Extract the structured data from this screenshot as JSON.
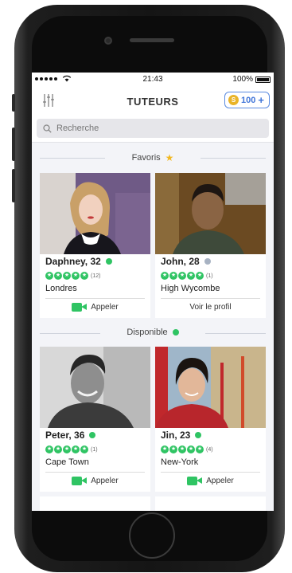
{
  "status_bar": {
    "time": "21:43",
    "battery": "100%"
  },
  "nav": {
    "title": "TUTEURS",
    "coins": "100",
    "coin_symbol": "S"
  },
  "search": {
    "placeholder": "Recherche"
  },
  "sections": {
    "favorites": "Favoris",
    "available": "Disponible"
  },
  "tutors": [
    {
      "name": "Daphney, 32",
      "online": true,
      "reviews": "(12)",
      "city": "Londres",
      "action": "Appeler",
      "photo_tone": "#8a6b9a"
    },
    {
      "name": "John, 28",
      "online": false,
      "reviews": "(1)",
      "city": "High Wycombe",
      "action": "Voir le profil",
      "photo_tone": "#7a5a2e"
    },
    {
      "name": "Peter, 36",
      "online": true,
      "reviews": "(1)",
      "city": "Cape Town",
      "action": "Appeler",
      "photo_tone": "#3a3a3a"
    },
    {
      "name": "Jin, 23",
      "online": true,
      "reviews": "(4)",
      "city": "New-York",
      "action": "Appeler",
      "photo_tone": "#c23a3a"
    }
  ],
  "colors": {
    "accent": "#3f74d8",
    "online": "#2fc463",
    "offline": "#a7b2c2",
    "star": "#f2b822"
  }
}
